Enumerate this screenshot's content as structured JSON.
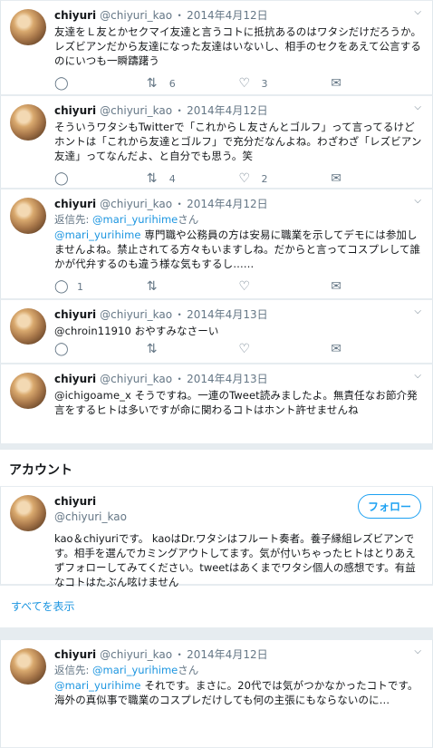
{
  "tweets": [
    {
      "name": "chiyuri",
      "handle": "@chiyuri_kao",
      "date": "2014年4月12日",
      "text": "友達をＬ友とかセクマイ友達と言うコトに抵抗あるのはワタシだけだろうか。レズビアンだから友達になった友達はいないし、相手のセクをあえて公言するのにいつも一瞬躊躇う",
      "reply_count": "",
      "retweet_count": "6",
      "like_count": "3"
    },
    {
      "name": "chiyuri",
      "handle": "@chiyuri_kao",
      "date": "2014年4月12日",
      "text": "そういうワタシもTwitterで「これからＬ友さんとゴルフ」って言ってるけどホントは「これから友達とゴルフ」で充分だなんよね。わざわざ「レズビアン友達」ってなんだよ、と自分でも思う。笑",
      "reply_count": "",
      "retweet_count": "4",
      "like_count": "2"
    },
    {
      "name": "chiyuri",
      "handle": "@chiyuri_kao",
      "date": "2014年4月12日",
      "reply_prefix": "返信先: ",
      "reply_to": "@mari_yurihime",
      "reply_suffix": "さん",
      "mention": "@mari_yurihime",
      "text": " 専門職や公務員の方は安易に職業を示してデモには参加しませんよね。禁止されてる方々もいますしね。だからと言ってコスプレして誰かが代弁するのも違う様な気もするし……",
      "reply_count": "1",
      "retweet_count": "",
      "like_count": ""
    },
    {
      "name": "chiyuri",
      "handle": "@chiyuri_kao",
      "date": "2014年4月13日",
      "text": "@chroin11910 おやすみなさーい",
      "reply_count": "",
      "retweet_count": "",
      "like_count": ""
    },
    {
      "name": "chiyuri",
      "handle": "@chiyuri_kao",
      "date": "2014年4月13日",
      "text": "@ichigoame_x そうですね。一連のTweet読みましたよ。無責任なお節介発言をするヒトは多いですが命に関わるコトはホント許せませんね",
      "reply_count": "",
      "retweet_count": "",
      "like_count": ""
    }
  ],
  "account": {
    "section_title": "アカウント",
    "name": "chiyuri",
    "handle": "@chiyuri_kao",
    "follow_label": "フォロー",
    "bio": "kao＆chiyuriです。 kaoはDr.ワタシはフルート奏者。養子縁組レズビアンです。相手を選んでカミングアウトしてます。気が付いちゃったヒトはとりあえずフォローしてみてください。tweetはあくまでワタシ個人の感想です。有益なコトはたぶん呟けません",
    "show_all": "すべてを表示"
  },
  "last_tweet": {
    "name": "chiyuri",
    "handle": "@chiyuri_kao",
    "date": "2014年4月12日",
    "reply_prefix": "返信先: ",
    "reply_to": "@mari_yurihime",
    "reply_suffix": "さん",
    "mention": "@mari_yurihime",
    "text": " それです。まさに。20代では気がつかなかったコトです。海外の真似事で職業のコスプレだけしても何の主張にもならないのに…"
  },
  "colors": {
    "accent": "#1da1f2",
    "link": "#1b95e0",
    "muted": "#657786",
    "background": "#e6ecf0"
  },
  "icons": {
    "reply": "reply-icon",
    "retweet": "retweet-icon",
    "like": "like-icon",
    "mail": "mail-icon",
    "caret": "chevron-down-icon"
  }
}
